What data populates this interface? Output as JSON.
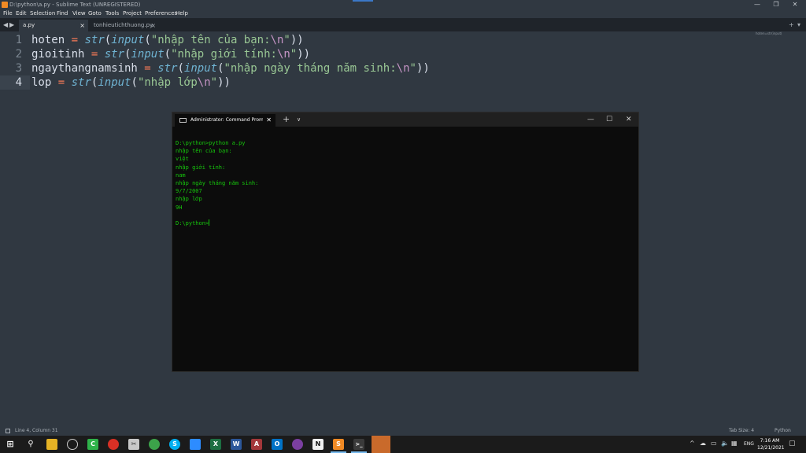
{
  "window": {
    "title": "D:\\python\\a.py - Sublime Text (UNREGISTERED)",
    "controls": {
      "minimize": "—",
      "maximize": "❐",
      "close": "✕"
    }
  },
  "menu": [
    "File",
    "Edit",
    "Selection",
    "Find",
    "View",
    "Goto",
    "Tools",
    "Project",
    "Preferences",
    "Help"
  ],
  "tabs": [
    {
      "label": "a.py",
      "close": "×",
      "active": true
    },
    {
      "label": "tonhieutichthuong.py",
      "close": "×",
      "active": false
    }
  ],
  "minimap_label": "hoten=str(input(",
  "editor": {
    "current_line": 4,
    "lines": [
      {
        "num": "1",
        "var": "hoten",
        "eq": "=",
        "fn1": "str",
        "p1": "(",
        "fn2": "input",
        "p2": "(",
        "str1": "\"nhập tên của bạn:",
        "esc": "\\n",
        "str2": "\"",
        "close": "))"
      },
      {
        "num": "2",
        "var": "gioitinh",
        "eq": "=",
        "fn1": "str",
        "p1": "(",
        "fn2": "input",
        "p2": "(",
        "str1": "\"nhập giới tính:",
        "esc": "\\n",
        "str2": "\"",
        "close": "))"
      },
      {
        "num": "3",
        "var": "ngaythangnamsinh",
        "eq": "=",
        "fn1": "str",
        "p1": "(",
        "fn2": "input",
        "p2": "(",
        "str1": "\"nhập ngày tháng năm sinh:",
        "esc": "\\n",
        "str2": "\"",
        "close": "))"
      },
      {
        "num": "4",
        "var": "lop",
        "eq": "=",
        "fn1": "str",
        "p1": "(",
        "fn2": "input",
        "p2": "(",
        "str1": "\"nhập lớp",
        "esc": "\\n",
        "str2": "\"",
        "close": "))"
      }
    ]
  },
  "terminal": {
    "tab_title": "Administrator: Command Prompt",
    "tab_close": "✕",
    "new_tab": "+",
    "dropdown": "∨",
    "controls": {
      "minimize": "—",
      "maximize": "☐",
      "close": "✕"
    },
    "output": [
      "D:\\python>python a.py",
      "nhập tên của bạn:",
      "việt",
      "nhập giới tính:",
      "nam",
      "nhập ngày tháng năm sinh:",
      "9/7/2007",
      "nhập lớp",
      "9H",
      ""
    ],
    "prompt": "D:\\python>"
  },
  "statusbar": {
    "position": "Line 4, Column 31",
    "tab_size": "Tab Size: 4",
    "syntax": "Python"
  },
  "taskbar": {
    "tray": {
      "language": "ENG",
      "time": "7:16 AM",
      "date": "12/21/2021"
    }
  },
  "colors": {
    "editor_bg": "#303841",
    "terminal_text": "#16c60c",
    "keyword_op": "#f97b58",
    "function": "#6fb3d2",
    "string": "#99c794"
  }
}
